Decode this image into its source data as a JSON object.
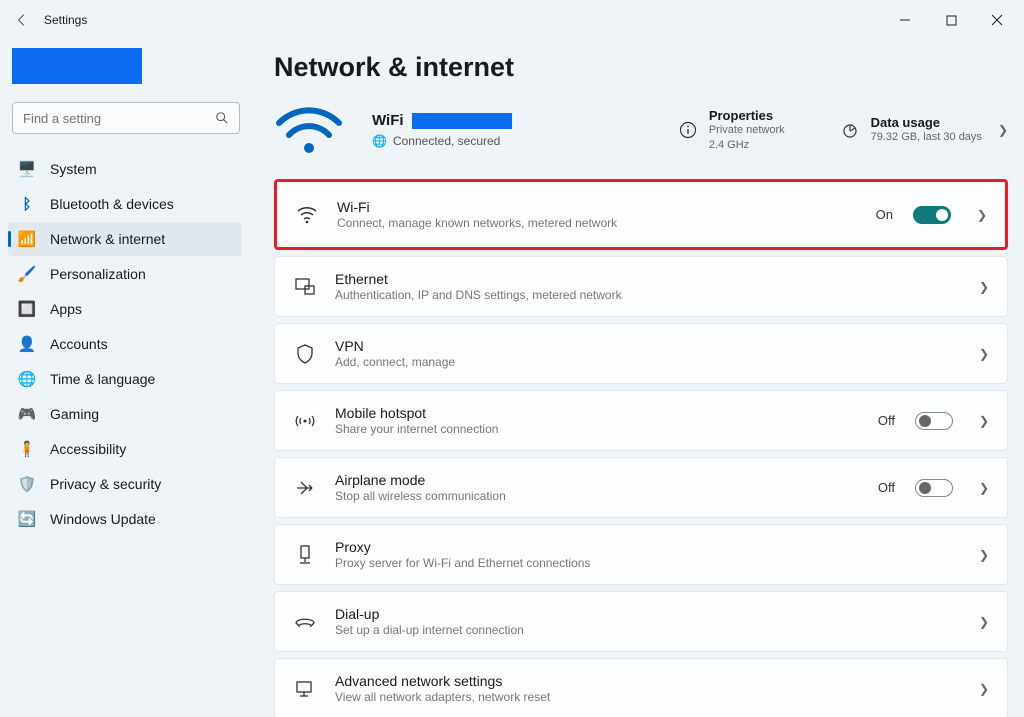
{
  "window": {
    "title": "Settings"
  },
  "search": {
    "placeholder": "Find a setting"
  },
  "nav": {
    "system": "System",
    "bluetooth": "Bluetooth & devices",
    "network": "Network & internet",
    "personalization": "Personalization",
    "apps": "Apps",
    "accounts": "Accounts",
    "time": "Time & language",
    "gaming": "Gaming",
    "accessibility": "Accessibility",
    "privacy": "Privacy & security",
    "update": "Windows Update"
  },
  "page": {
    "title": "Network & internet"
  },
  "status": {
    "conn_name": "WiFi",
    "conn_sub": "Connected, secured",
    "properties": {
      "title": "Properties",
      "line1": "Private network",
      "line2": "2.4 GHz"
    },
    "usage": {
      "title": "Data usage",
      "line1": "79.32 GB, last 30 days"
    }
  },
  "cards": {
    "wifi": {
      "title": "Wi-Fi",
      "sub": "Connect, manage known networks, metered network",
      "state": "On"
    },
    "ethernet": {
      "title": "Ethernet",
      "sub": "Authentication, IP and DNS settings, metered network"
    },
    "vpn": {
      "title": "VPN",
      "sub": "Add, connect, manage"
    },
    "hotspot": {
      "title": "Mobile hotspot",
      "sub": "Share your internet connection",
      "state": "Off"
    },
    "airplane": {
      "title": "Airplane mode",
      "sub": "Stop all wireless communication",
      "state": "Off"
    },
    "proxy": {
      "title": "Proxy",
      "sub": "Proxy server for Wi-Fi and Ethernet connections"
    },
    "dialup": {
      "title": "Dial-up",
      "sub": "Set up a dial-up internet connection"
    },
    "advanced": {
      "title": "Advanced network settings",
      "sub": "View all network adapters, network reset"
    }
  }
}
